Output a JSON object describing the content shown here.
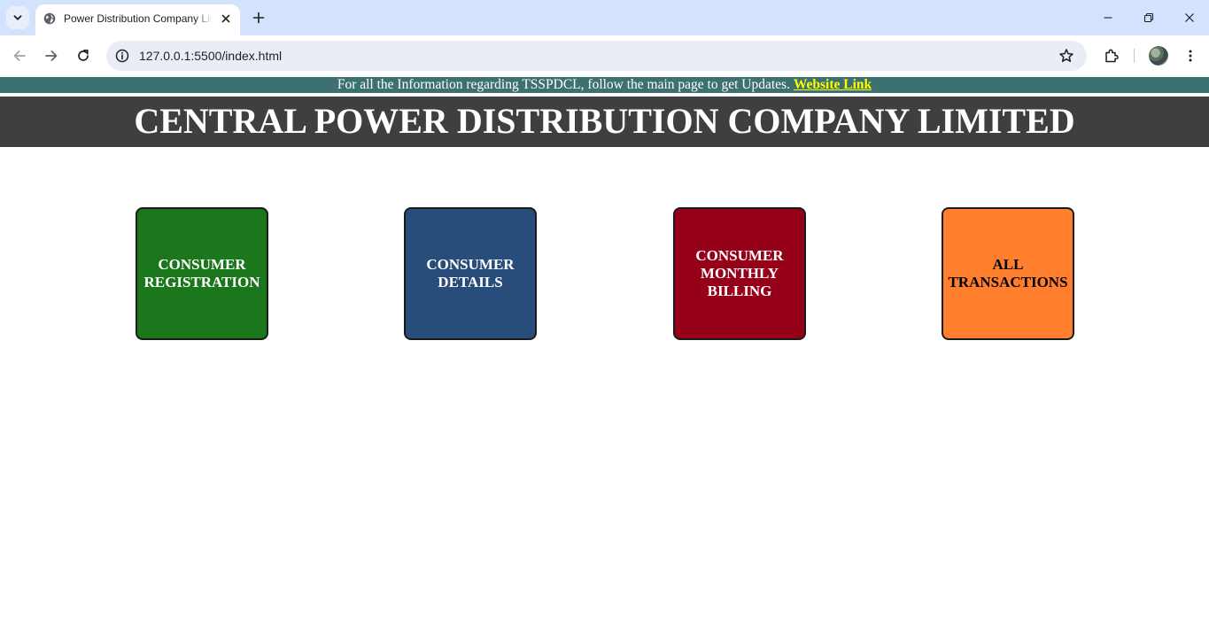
{
  "browser": {
    "tab": {
      "title": "Power Distribution Company Limited"
    },
    "address_bar": {
      "url": "127.0.0.1:5500/index.html"
    }
  },
  "page": {
    "notice": {
      "text": "For all the Information regarding TSSPDCL, follow the main page to get Updates.",
      "link_text": "Website Link"
    },
    "header": {
      "title": "CENTRAL POWER DISTRIBUTION COMPANY LIMITED"
    },
    "cards": [
      {
        "lines": [
          "CONSUMER",
          "REGISTRATION"
        ],
        "color": "#1b771b",
        "text_color": "#ffffff"
      },
      {
        "lines": [
          "CONSUMER",
          "DETAILS"
        ],
        "color": "#284d7a",
        "text_color": "#ffffff"
      },
      {
        "lines": [
          "CONSUMER",
          "MONTHLY",
          "BILLING"
        ],
        "color": "#960018",
        "text_color": "#ffffff"
      },
      {
        "lines": [
          "ALL",
          "TRANSACTIONS"
        ],
        "color": "#ff7f2f",
        "text_color": "#000000"
      }
    ]
  },
  "colors": {
    "tabstrip_bg": "#d3e3fd",
    "notice_bg": "#3c7071",
    "header_bg": "#3f3f3f",
    "link": "#ffff00"
  },
  "icons": [
    "tab-search-icon",
    "globe-favicon-icon",
    "close-icon",
    "plus-icon",
    "minimize-icon",
    "restore-icon",
    "window-close-icon",
    "back-arrow-icon",
    "forward-arrow-icon",
    "reload-icon",
    "site-info-icon",
    "star-icon",
    "puzzle-extension-icon",
    "kebab-menu-icon"
  ]
}
